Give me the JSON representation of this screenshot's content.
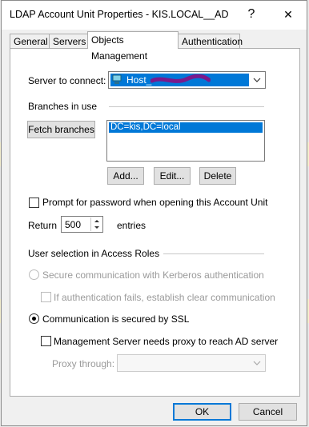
{
  "window": {
    "title": "LDAP Account Unit Properties - KIS.LOCAL__AD",
    "help_glyph": "?",
    "close_glyph": "✕"
  },
  "tabs": [
    {
      "label": "General"
    },
    {
      "label": "Servers"
    },
    {
      "label": "Objects Management"
    },
    {
      "label": "Authentication"
    }
  ],
  "server_connect": {
    "label": "Server to connect:",
    "value": "Host_"
  },
  "branches": {
    "section_label": "Branches in use",
    "fetch_label": "Fetch branches",
    "items": [
      "DC=kis,DC=local"
    ],
    "add_label": "Add...",
    "edit_label": "Edit...",
    "delete_label": "Delete"
  },
  "prompt_password": {
    "label": "Prompt for password when opening this Account Unit",
    "checked": false
  },
  "return_entries": {
    "prefix": "Return",
    "value": "500",
    "suffix": "entries"
  },
  "access_roles": {
    "section_label": "User selection in Access Roles",
    "kerberos_label": "Secure communication with Kerberos authentication",
    "clear_comm_label": "If authentication fails, establish clear communication",
    "ssl_label": "Communication is secured by SSL",
    "proxy_needed_label": "Management Server needs proxy to reach AD server",
    "proxy_through_label": "Proxy through:",
    "proxy_through_value": ""
  },
  "footer": {
    "ok_label": "OK",
    "cancel_label": "Cancel"
  },
  "colors": {
    "accent": "#0078d7",
    "selection_text": "#ffffff",
    "redaction": "#7a1a8c"
  },
  "icons": {
    "server_icon": "server-icon",
    "dropdown": "chevron-down-icon"
  }
}
